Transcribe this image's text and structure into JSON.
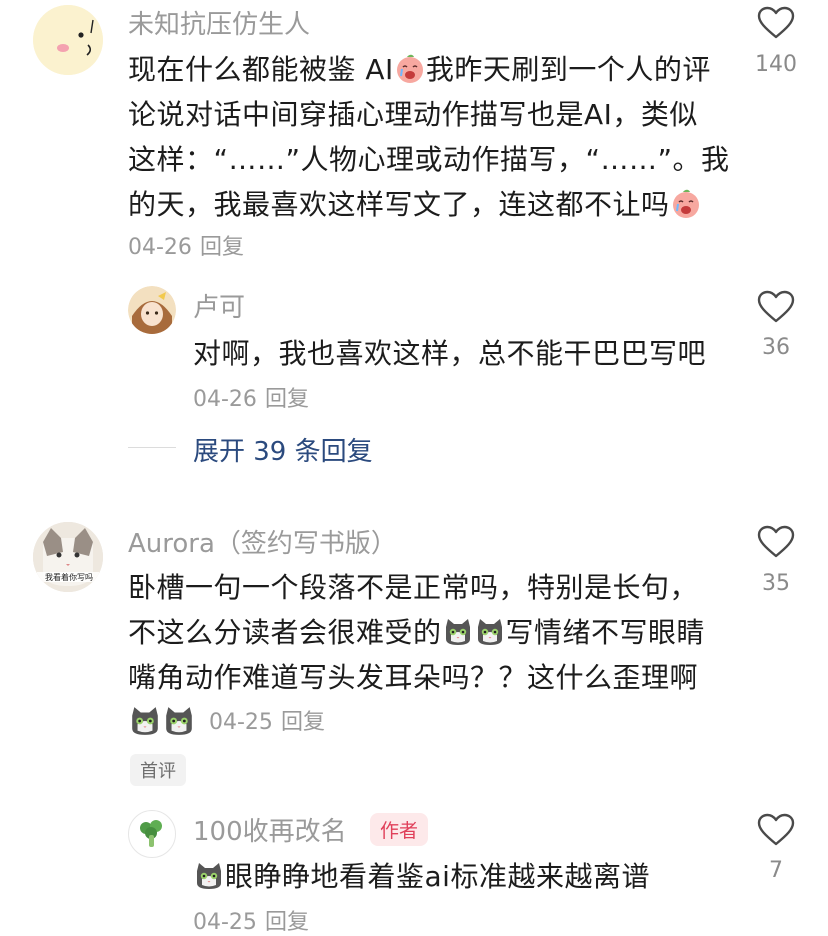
{
  "comments": [
    {
      "user": "未知抗压仿生人",
      "lines": [
        [
          "现在什么都能被鉴 AI",
          "[sad-face]",
          "我昨天刷到一个人的评"
        ],
        [
          "论说对话中间穿插心理动作描写也是AI，类似"
        ],
        [
          "这样：“……”人物心理或动作描写，“……”。我"
        ],
        [
          "的天，我最喜欢这样写文了，连这都不让吗",
          "[sad-face]"
        ]
      ],
      "date": "04-26",
      "reply_label": "回复",
      "likes": "140",
      "replies": [
        {
          "user": "卢可",
          "text": "对啊，我也喜欢这样，总不能干巴巴写吧",
          "date": "04-26",
          "reply_label": "回复",
          "likes": "36"
        }
      ],
      "expand_label": "展开 39 条回复"
    },
    {
      "user": "Aurora（签约写书版）",
      "avatar_caption": "我看着你写吗",
      "lines": [
        [
          "卧槽一句一个段落不是正常吗，特别是长句，"
        ],
        [
          "不这么分读者会很难受的",
          "[cat]",
          "[cat]",
          "写情绪不写眼睛"
        ],
        [
          "嘴角动作难道写头发耳朵吗？？这什么歪理啊"
        ]
      ],
      "trailing_emojis": [
        "[cat]",
        "[cat]"
      ],
      "date": "04-25",
      "reply_label": "回复",
      "likes": "35",
      "badge": "首评",
      "replies": [
        {
          "user": "100收再改名",
          "author_tag": "作者",
          "leading_emoji": "[cat]",
          "text": "眼睁睁地看着鉴ai标准越来越离谱",
          "date": "04-25",
          "reply_label": "回复",
          "likes": "7"
        }
      ]
    }
  ],
  "colors": {
    "username": "#9a9a9a",
    "body": "#1c1c1c",
    "link": "#2b4a7e",
    "author_tag_bg": "#fde9ea",
    "author_tag_fg": "#e0405a"
  },
  "icons": {
    "like": "heart-outline-icon",
    "sad": "crying-peach-emoji",
    "cat": "cat-face-emoji",
    "plant": "broccoli-icon"
  }
}
